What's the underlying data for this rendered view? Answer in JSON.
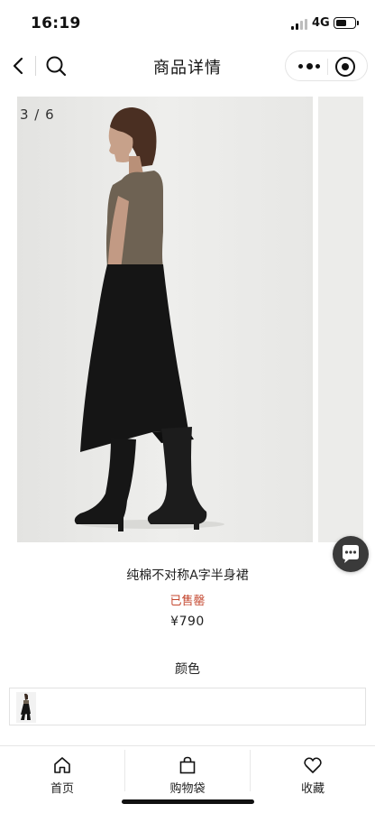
{
  "status_bar": {
    "time": "16:19",
    "network": "4G",
    "battery_level": 0.6
  },
  "nav": {
    "title": "商品详情"
  },
  "gallery": {
    "indicator": "3 / 6",
    "current": 3,
    "total": 6
  },
  "product": {
    "name": "纯棉不对称A字半身裙",
    "stock_status": "已售罄",
    "price": "¥790",
    "color_label": "颜色"
  },
  "tabs": [
    {
      "label": "首页",
      "icon": "home-icon"
    },
    {
      "label": "购物袋",
      "icon": "shopping-bag-icon"
    },
    {
      "label": "收藏",
      "icon": "heart-icon"
    }
  ],
  "colors": {
    "accent_sold_out": "#c4472f",
    "text": "#222222",
    "background": "#ffffff"
  }
}
